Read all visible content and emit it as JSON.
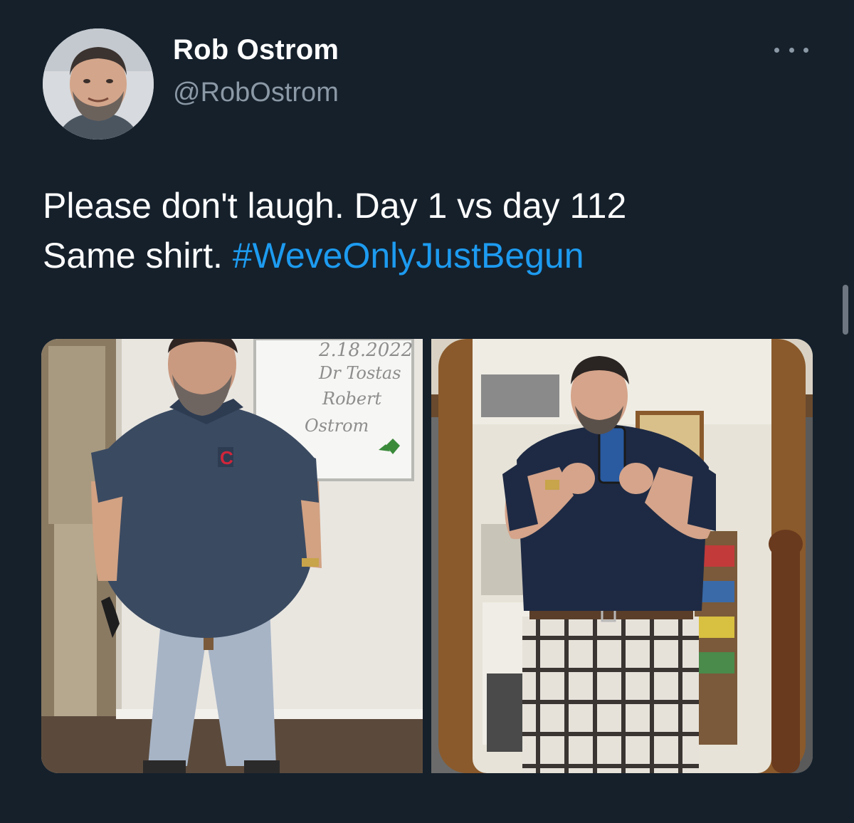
{
  "author": {
    "display_name": "Rob Ostrom",
    "handle": "@RobOstrom"
  },
  "tweet": {
    "line1": "Please don't laugh. Day 1 vs day 112",
    "line2_prefix": "Same shirt. ",
    "hashtag": "#WeveOnlyJustBegun"
  },
  "media": {
    "photo1": {
      "whiteboard_lines": [
        "2.18.2022",
        "Dr Tostas",
        "Robert",
        "Ostrom"
      ],
      "shirt_logo": "C"
    },
    "photo2": {}
  },
  "icons": {
    "more": "more-horizontal-icon"
  },
  "colors": {
    "background": "#15202b",
    "link": "#1d9bf0",
    "secondary_text": "#8b98a5"
  }
}
